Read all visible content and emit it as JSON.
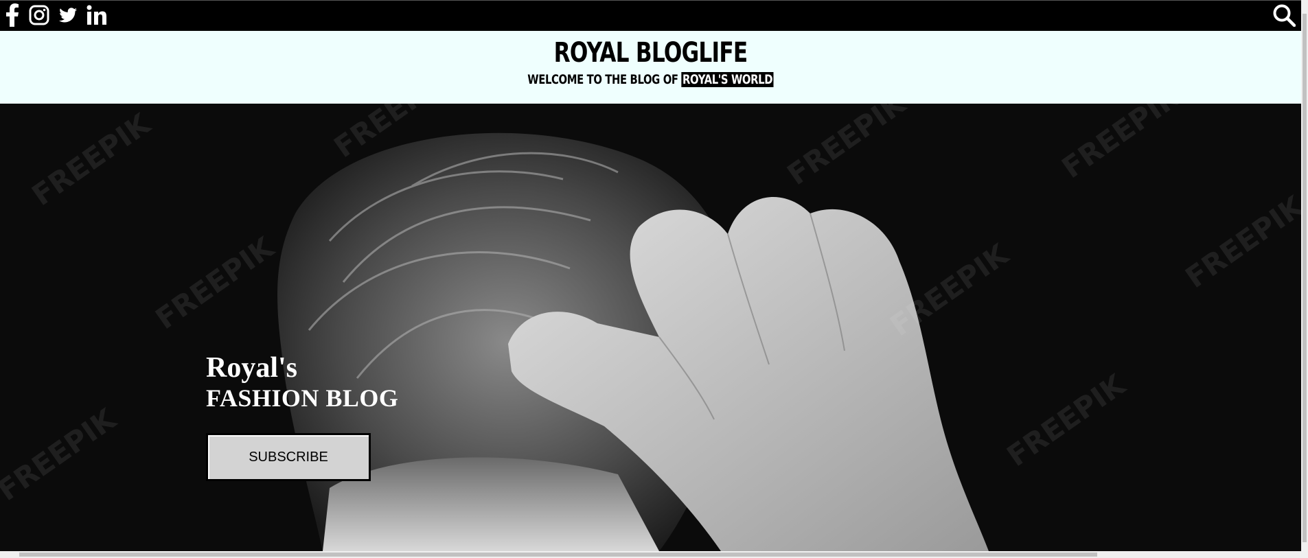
{
  "social": {
    "icons": [
      "facebook-icon",
      "instagram-icon",
      "twitter-icon",
      "linkedin-icon"
    ]
  },
  "search": {
    "icon": "search-icon"
  },
  "header": {
    "title": "ROYAL BLOGLIFE",
    "tagline_prefix": "WELCOME TO THE BLOG OF",
    "tagline_highlight": "ROYAL'S WORLD"
  },
  "hero": {
    "line1": "Royal's",
    "line2": "FASHION BLOG",
    "subscribe_label": "SUBSCRIBE",
    "watermark": "FREEPIK"
  },
  "colors": {
    "header_bg": "#effffe",
    "topbar_bg": "#000000",
    "button_bg": "#d3d3d3"
  }
}
